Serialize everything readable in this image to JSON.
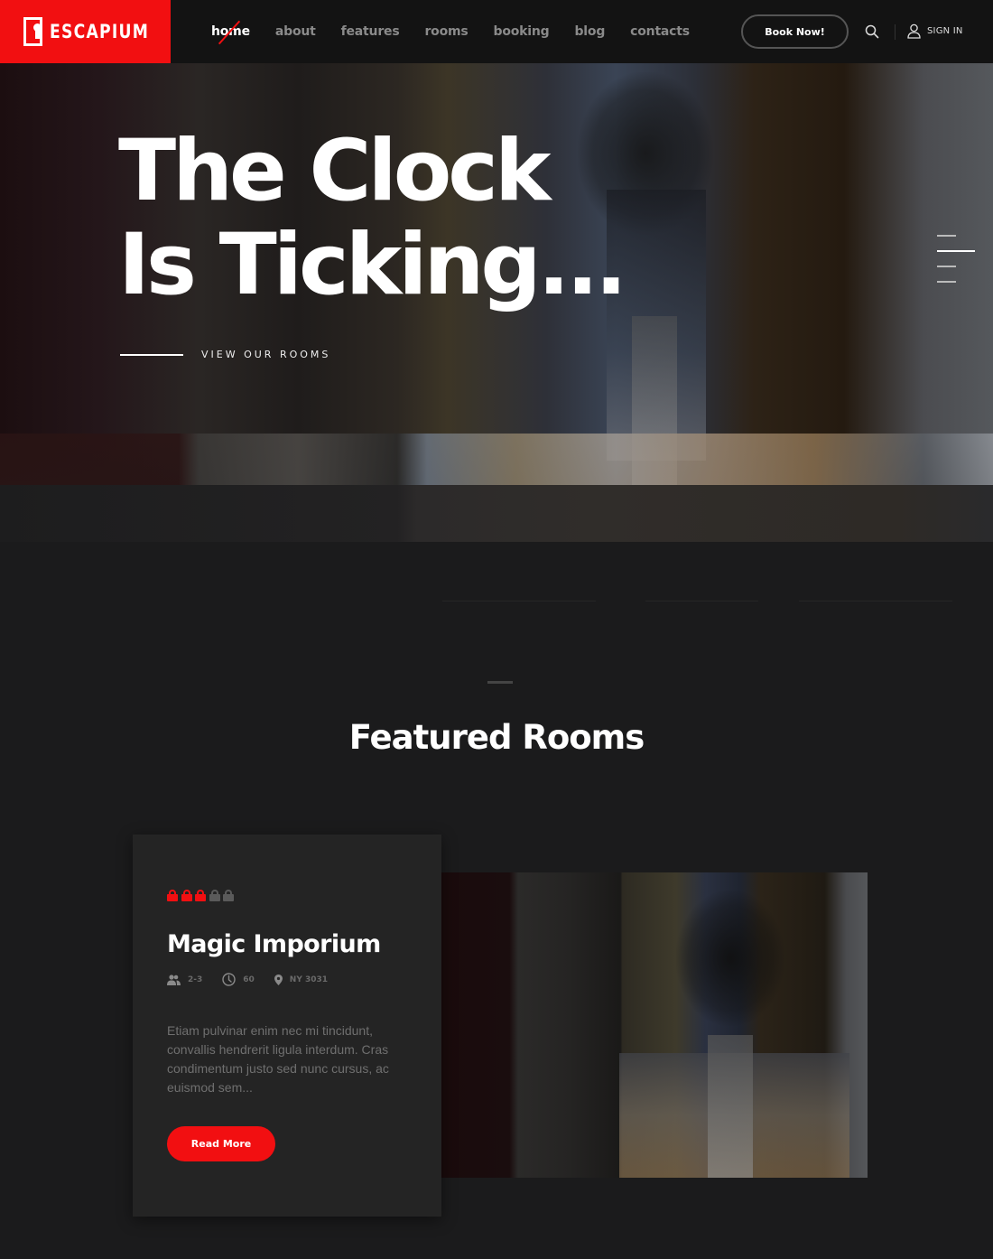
{
  "brand": {
    "name": "ESCAPIUM",
    "accent_color": "#f20f11"
  },
  "nav": {
    "items": [
      {
        "label": "home",
        "active": true
      },
      {
        "label": "about",
        "active": false
      },
      {
        "label": "features",
        "active": false
      },
      {
        "label": "rooms",
        "active": false
      },
      {
        "label": "booking",
        "active": false
      },
      {
        "label": "blog",
        "active": false
      },
      {
        "label": "contacts",
        "active": false
      }
    ],
    "book_button": "Book Now!",
    "search_icon": "search-icon",
    "signin_label": "SIGN IN"
  },
  "hero": {
    "title_line1": "The Clock",
    "title_line2": "Is Ticking...",
    "cta_label": "VIEW OUR ROOMS",
    "slides_total": 4,
    "active_slide": 2
  },
  "featured": {
    "title": "Featured Rooms",
    "room": {
      "name": "Magic Imporium",
      "difficulty": {
        "value": 3,
        "max": 5
      },
      "players": "2-3",
      "duration": "60",
      "location": "NY 3031",
      "description": "Etiam pulvinar enim nec mi tincidunt, convallis hendrerit ligula interdum. Cras condimentum justo sed nunc cursus, ac euismod sem...",
      "button_label": "Read More"
    }
  }
}
